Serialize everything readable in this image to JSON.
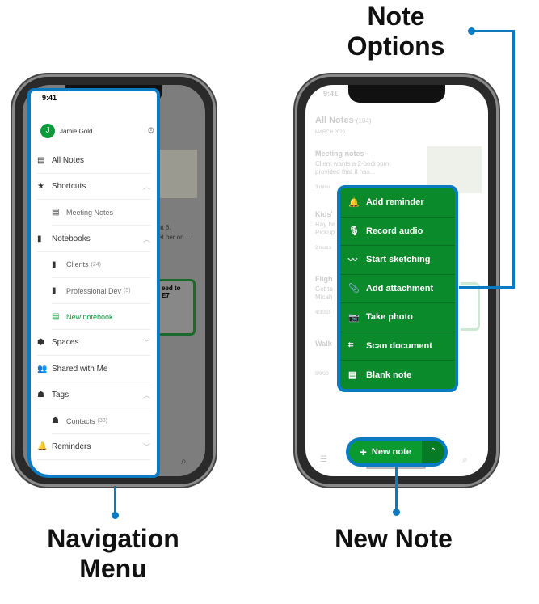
{
  "labels": {
    "note_options_1": "Note",
    "note_options_2": "Options",
    "nav_menu_1": "Navigation",
    "nav_menu_2": "Menu",
    "new_note": "New Note"
  },
  "status_time": "9:41",
  "left_phone": {
    "user": {
      "initial": "J",
      "name": "Jamie Gold"
    },
    "items": [
      {
        "label": "All Notes",
        "icon": "note-icon"
      },
      {
        "label": "Shortcuts",
        "icon": "star-icon",
        "chevron": "up"
      },
      {
        "label": "Meeting Notes",
        "icon": "note-icon",
        "sub": true
      },
      {
        "label": "Notebooks",
        "icon": "notebook-icon",
        "chevron": "up"
      },
      {
        "label": "Clients",
        "count": "(24)",
        "icon": "notebook-icon",
        "sub": true
      },
      {
        "label": "Professional Dev",
        "count": "(5)",
        "icon": "notebook-icon",
        "sub": true
      },
      {
        "label": "New notebook",
        "icon": "new-notebook-icon",
        "sub": true,
        "accent": true
      },
      {
        "label": "Spaces",
        "icon": "cube-icon",
        "chevron": "down"
      },
      {
        "label": "Shared with Me",
        "icon": "people-icon"
      },
      {
        "label": "Tags",
        "icon": "tag-icon",
        "chevron": "up"
      },
      {
        "label": "Contacts",
        "count": "(33)",
        "icon": "tag-icon",
        "sub": true
      },
      {
        "label": "Reminders",
        "icon": "bell-icon",
        "chevron": "down"
      }
    ],
    "background_text": [
      "at 6.",
      "et her on ...",
      "eed to",
      "E7"
    ]
  },
  "right_phone": {
    "title": "All Notes",
    "count": "(104)",
    "month": "MARCH 2020",
    "notes": [
      {
        "title": "Meeting notes",
        "line1": "Client wants a 2-bedroom",
        "line2": "provided that it has...",
        "time": "3 minu"
      },
      {
        "title": "Kids'",
        "line1": "Ray ha",
        "line2": "Pickup",
        "time": "2 hours"
      },
      {
        "title": "Fligh",
        "line1": "Get to",
        "line2": "Micah",
        "time": "4/30/20"
      },
      {
        "title": "Walk",
        "time": "5/9/20"
      }
    ],
    "menu": [
      {
        "label": "Add reminder",
        "icon": "bell-icon"
      },
      {
        "label": "Record audio",
        "icon": "microphone-icon"
      },
      {
        "label": "Start sketching",
        "icon": "sketch-icon"
      },
      {
        "label": "Add attachment",
        "icon": "paperclip-icon"
      },
      {
        "label": "Take photo",
        "icon": "camera-icon"
      },
      {
        "label": "Scan document",
        "icon": "scan-icon"
      },
      {
        "label": "Blank note",
        "icon": "blank-note-icon"
      }
    ],
    "new_note_label": "New note"
  },
  "colors": {
    "accent_green": "#0a8a2a",
    "callout_blue": "#0a7bc2"
  }
}
